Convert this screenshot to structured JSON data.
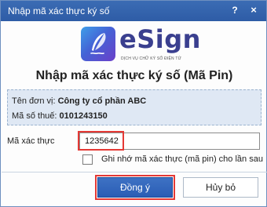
{
  "window": {
    "title": "Nhập mã xác thực ký số",
    "help_label": "?",
    "close_label": "×"
  },
  "brand": {
    "name": "eSign",
    "tagline": "DỊCH VỤ CHỮ KÝ SỐ ĐIỆN TỬ",
    "colors": {
      "logo_start": "#3f9fe8",
      "logo_end": "#6a3fc9",
      "brand_text": "#3a3f8f"
    }
  },
  "heading": "Nhập mã xác thực ký số (Mã Pin)",
  "info": {
    "unit_label": "Tên đơn vị:",
    "unit_value": "Công ty cổ phần ABC",
    "tax_label": "Mã số thuế:",
    "tax_value": "0101243150"
  },
  "pin": {
    "label": "Mã xác thực",
    "value": "1235642"
  },
  "remember": {
    "label": "Ghi nhớ mã xác thực (mã pin) cho lần sau",
    "checked": false
  },
  "buttons": {
    "ok_label": "Đồng ý",
    "cancel_label": "Hủy bỏ"
  },
  "colors": {
    "titlebar": "#2e5ca6",
    "primary_button": "#2a5db5",
    "highlight": "#e53935",
    "info_bg": "#dfe8f4"
  },
  "icons": {
    "logo": "feather-quill-icon",
    "help": "help-icon",
    "close": "close-icon"
  }
}
